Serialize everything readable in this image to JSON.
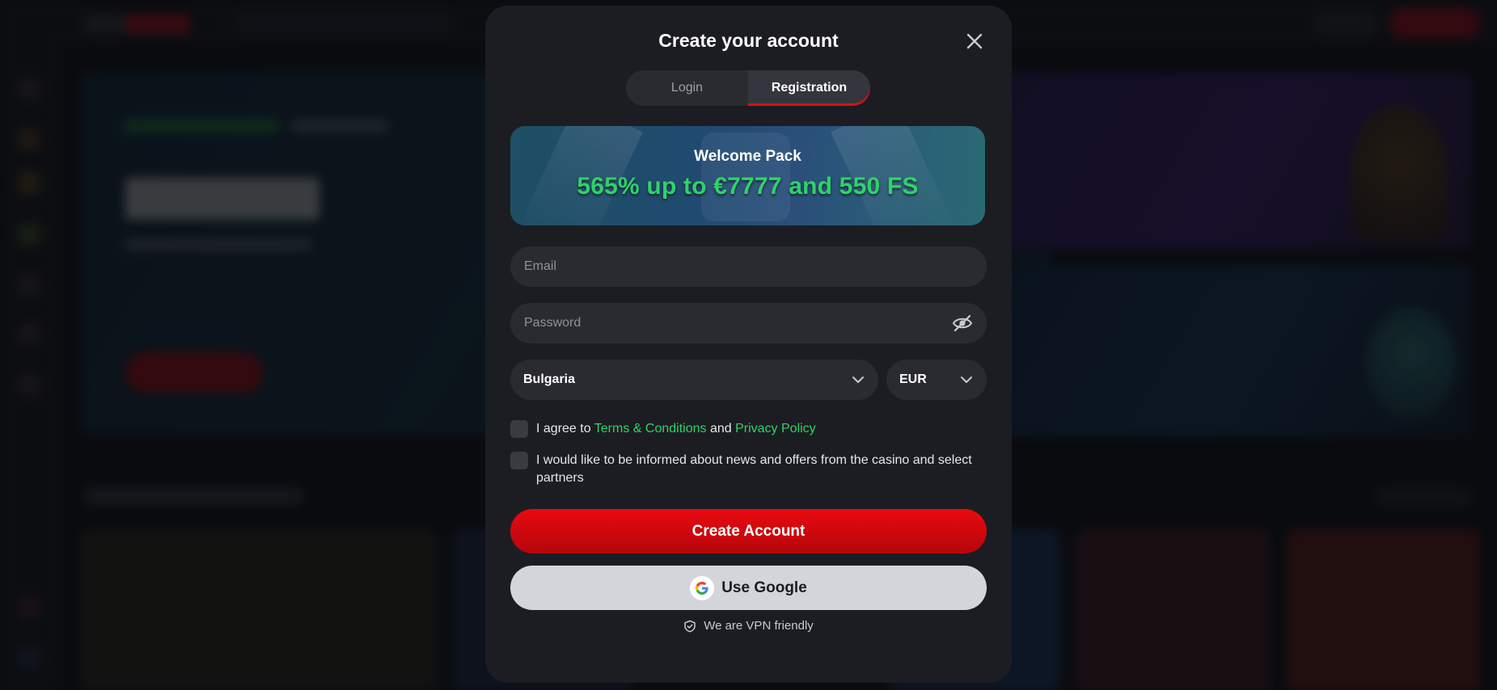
{
  "modal": {
    "title": "Create your account",
    "tabs": [
      {
        "label": "Login",
        "active": false
      },
      {
        "label": "Registration",
        "active": true
      }
    ],
    "welcome": {
      "label": "Welcome Pack",
      "offer": "565% up to €7777 and 550 FS"
    },
    "form": {
      "email_placeholder": "Email",
      "password_placeholder": "Password",
      "country": "Bulgaria",
      "currency": "EUR",
      "terms": {
        "prefix": "I agree to",
        "terms_link": "Terms & Conditions",
        "conjunction": "and",
        "privacy_link": "Privacy Policy",
        "checked": false
      },
      "newsletter": {
        "label": "I would like to be informed about news and offers from the casino and select partners",
        "checked": false
      },
      "submit_label": "Create Account",
      "google_label": "Use Google"
    },
    "vpn_note": "We are VPN friendly"
  },
  "icons": {
    "close": "close-icon",
    "password_visibility": "eye-off-icon",
    "dropdown": "chevron-down-icon",
    "google": "google-icon",
    "vpn": "shield-icon"
  },
  "colors": {
    "accent_green": "#2fd26a",
    "primary_red": "#e80a10",
    "modal_bg": "#1c1d22",
    "field_bg": "#2a2b31"
  }
}
